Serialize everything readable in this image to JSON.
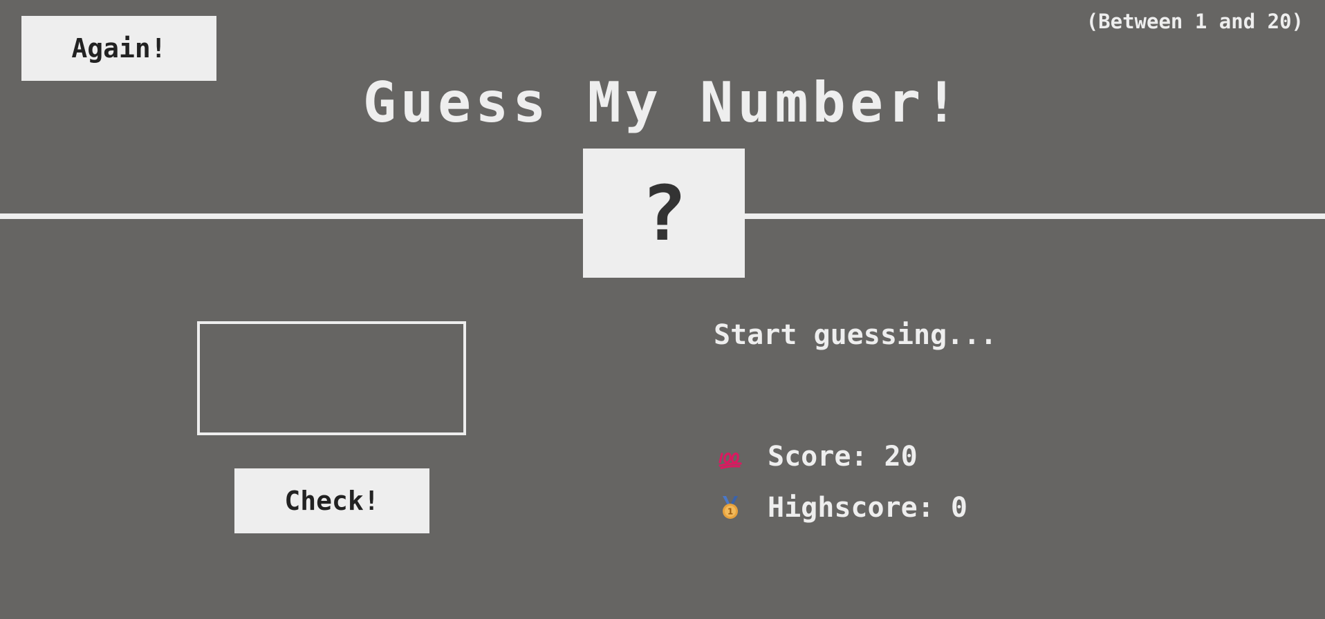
{
  "again_label": "Again!",
  "range_hint": "(Between 1 and 20)",
  "title": "Guess My Number!",
  "secret_number": "?",
  "guess_input": {
    "value": "",
    "placeholder": ""
  },
  "check_label": "Check!",
  "message": "Start guessing...",
  "score": {
    "icon": "hundred-points-icon",
    "label": "Score:",
    "value": "20"
  },
  "highscore": {
    "icon": "medal-icon",
    "label": "Highscore:",
    "value": "0"
  },
  "colors": {
    "background": "#666563",
    "foreground": "#eeeeee",
    "dark_text": "#222222",
    "score_icon": "#d81b60",
    "medal_ribbon": "#4a78c8",
    "medal_gold": "#e8a23c"
  }
}
